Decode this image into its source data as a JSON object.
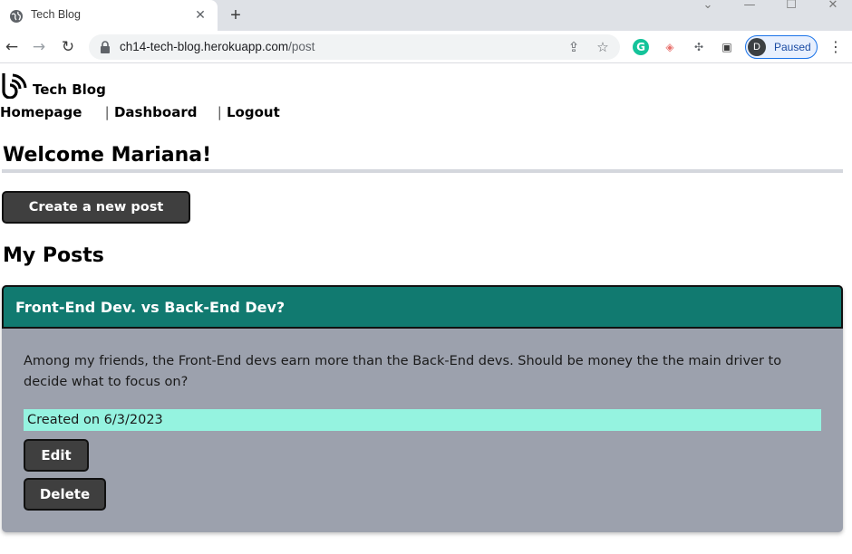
{
  "browser": {
    "tab_title": "Tech Blog",
    "tab_close": "✕",
    "new_tab": "+",
    "url_host": "ch14-tech-blog.herokuapp.com",
    "url_path": "/post",
    "profile_initial": "D",
    "profile_status": "Paused",
    "window_controls": {
      "minimize": "—",
      "maximize": "☐",
      "close": "✕",
      "dropdown": "⌄"
    },
    "nav": {
      "back": "←",
      "forward": "→",
      "reload": "↻"
    },
    "menu": "⋮"
  },
  "site": {
    "title": "Tech Blog",
    "nav": [
      {
        "label": "Homepage"
      },
      {
        "label": "Dashboard"
      },
      {
        "label": "Logout"
      }
    ],
    "separator": "|"
  },
  "dashboard": {
    "welcome": "Welcome Mariana!",
    "create_button": "Create a new post",
    "section_title": "My Posts"
  },
  "posts": [
    {
      "title": "Front-End Dev. vs Back-End Dev?",
      "body": "Among my friends, the Front-End devs earn more than the Back-End devs. Should be money the the main driver to decide what to focus on?",
      "created": "Created on 6/3/2023",
      "edit_label": "Edit",
      "delete_label": "Delete"
    }
  ],
  "colors": {
    "post_header": "#117a70",
    "post_card": "#9ca1ad",
    "date_highlight": "#95f3e0",
    "button_dark": "#3f3f3f"
  }
}
